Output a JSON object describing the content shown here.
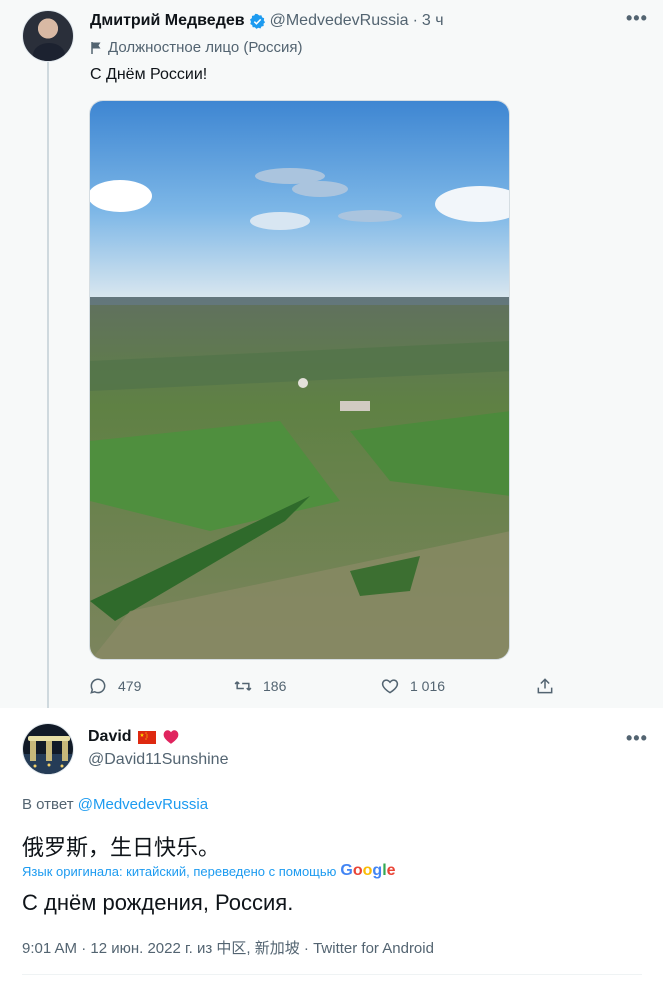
{
  "colors": {
    "accent": "#1d9bf0",
    "muted": "#536471",
    "text": "#0f1419",
    "panel": "#f7f9f9"
  },
  "tweet": {
    "author_name": "Дмитрий Медведев",
    "author_handle": "@MedvedevRussia",
    "separator": "·",
    "time": "3 ч",
    "label": "Должностное лицо (Россия)",
    "text": "С Днём России!",
    "media": "landscape-photo",
    "stats": {
      "replies": "479",
      "retweets": "186",
      "likes": "1 016"
    },
    "more_label": "•••"
  },
  "reply": {
    "author_name": "David",
    "author_handle": "@David11Sunshine",
    "reply_prefix": "В ответ",
    "reply_to": "@MedvedevRussia",
    "original_text": "俄罗斯，生日快乐。",
    "translation_note": "Язык оригинала: китайский, переведено с помощью",
    "translation_provider": "Google",
    "translated_text": "С днём рождения, Россия.",
    "meta": "9:01 AM · 12 июн. 2022 г. из 中区, 新加坡 · Twitter for Android",
    "more_label": "•••"
  }
}
